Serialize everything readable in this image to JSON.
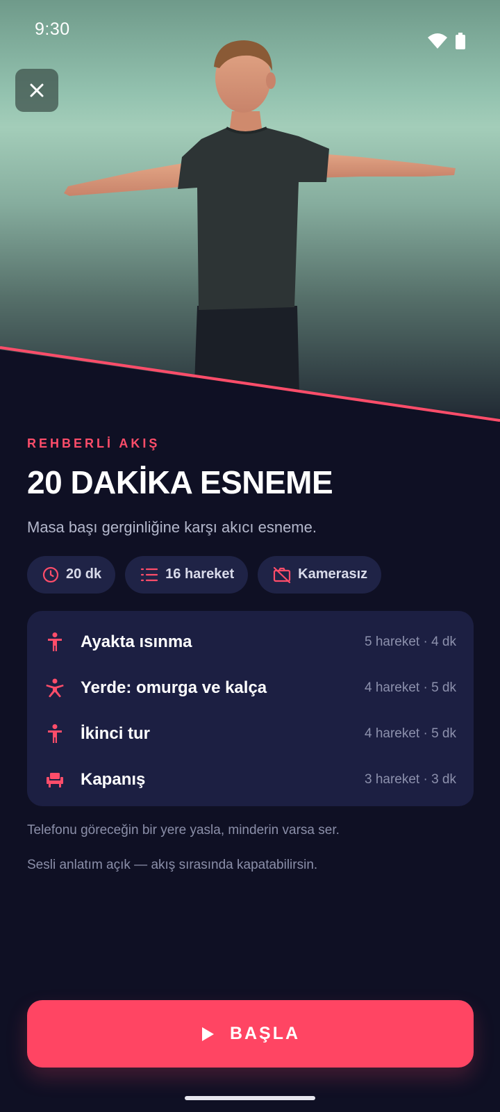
{
  "status": {
    "time": "9:30"
  },
  "hero": {
    "image": "man in dark t-shirt with arms extended sideways"
  },
  "header": {
    "eyebrow": "REHBERLİ AKIŞ",
    "title": "20 DAKİKA ESNEME",
    "subtitle": "Masa başı gerginliğine karşı akıcı esneme."
  },
  "chips": [
    {
      "icon": "clock-icon",
      "label": "20 dk"
    },
    {
      "icon": "list-icon",
      "label": "16 hareket"
    },
    {
      "icon": "camera-off-icon",
      "label": "Kamerasız"
    }
  ],
  "sections": [
    {
      "icon": "standing-person-icon",
      "name": "Ayakta ısınma",
      "meta": "5 hareket · 4 dk"
    },
    {
      "icon": "stretching-person-icon",
      "name": "Yerde: omurga ve kalça",
      "meta": "4 hareket · 5 dk"
    },
    {
      "icon": "standing-person-icon",
      "name": "İkinci tur",
      "meta": "4 hareket · 5 dk"
    },
    {
      "icon": "chair-icon",
      "name": "Kapanış",
      "meta": "3 hareket · 3 dk"
    }
  ],
  "notes": [
    "Telefonu göreceğin bir yere yasla, minderin varsa ser.",
    "Sesli anlatım açık — akış sırasında kapatabilirsin."
  ],
  "cta": {
    "label": "BAŞLA"
  },
  "colors": {
    "accent": "#ff4563",
    "background": "#0f1024",
    "card": "#1c1f42",
    "chip": "#1f2346"
  }
}
